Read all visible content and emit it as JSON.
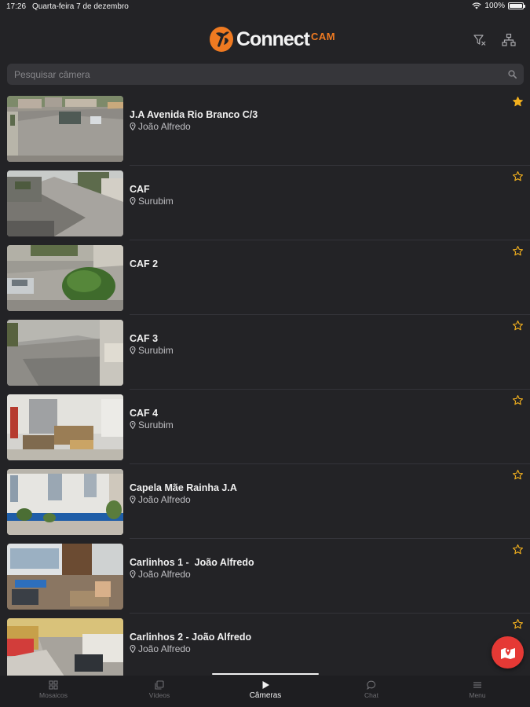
{
  "status": {
    "time": "17:26",
    "date": "Quarta-feira 7 de dezembro",
    "battery": "100%"
  },
  "header": {
    "brand": "Connect",
    "brand_sub": "CAM",
    "icons": [
      "filter-clear-icon",
      "hierarchy-icon"
    ]
  },
  "search": {
    "placeholder": "Pesquisar câmera",
    "value": ""
  },
  "cameras": [
    {
      "name": "J.A Avenida Rio Branco C/3",
      "location": "João Alfredo",
      "favorite": true
    },
    {
      "name": "CAF",
      "location": "Surubim",
      "favorite": false
    },
    {
      "name": "CAF 2",
      "location": "",
      "favorite": false
    },
    {
      "name": "CAF 3",
      "location": "Surubim",
      "favorite": false
    },
    {
      "name": "CAF 4",
      "location": "Surubim",
      "favorite": false
    },
    {
      "name": "Capela Mãe Rainha J.A",
      "location": "João Alfredo",
      "favorite": false
    },
    {
      "name": "Carlinhos 1 -  João Alfredo",
      "location": "João Alfredo",
      "favorite": false
    },
    {
      "name": "Carlinhos 2 - João Alfredo",
      "location": "João Alfredo",
      "favorite": false
    }
  ],
  "tabs": [
    {
      "label": "Mosaicos",
      "icon": "grid-icon",
      "active": false
    },
    {
      "label": "Vídeos",
      "icon": "copy-icon",
      "active": false
    },
    {
      "label": "Câmeras",
      "icon": "play-icon",
      "active": true
    },
    {
      "label": "Chat",
      "icon": "chat-icon",
      "active": false
    },
    {
      "label": "Menu",
      "icon": "menu-icon",
      "active": false
    }
  ],
  "colors": {
    "accent": "#ef7a21",
    "star": "#f2b01e",
    "fab": "#e53935",
    "background": "#232326"
  }
}
